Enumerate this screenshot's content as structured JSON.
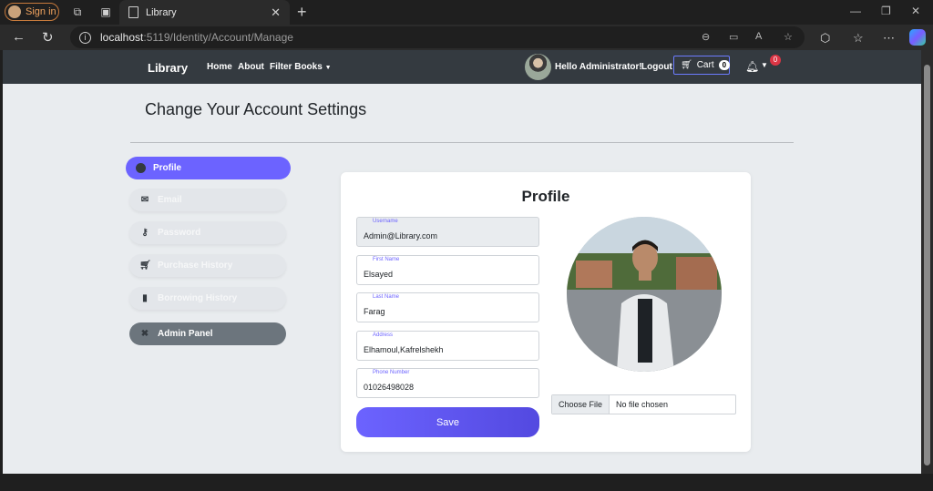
{
  "browser": {
    "signin_label": "Sign in",
    "tab_title": "Library",
    "url_host": "localhost",
    "url_path": ":5119/Identity/Account/Manage"
  },
  "navbar": {
    "brand": "Library",
    "links": [
      "Home",
      "About",
      "Filter Books"
    ],
    "greeting": "Hello Administrator!",
    "logout": "Logout",
    "cart_label": "Cart",
    "cart_count": "0",
    "notification_count": "0"
  },
  "page": {
    "heading": "Change Your Account Settings"
  },
  "sidebar": {
    "items": [
      {
        "label": "Profile",
        "icon": "user-circle-icon"
      },
      {
        "label": "Email",
        "icon": "envelope-icon"
      },
      {
        "label": "Password",
        "icon": "key-icon"
      },
      {
        "label": "Purchase History",
        "icon": "cart-icon"
      },
      {
        "label": "Borrowing History",
        "icon": "book-icon"
      },
      {
        "label": "Admin Panel",
        "icon": "tools-icon"
      }
    ]
  },
  "profile": {
    "title": "Profile",
    "fields": [
      {
        "label": "Username",
        "value": "Admin@Library.com"
      },
      {
        "label": "First Name",
        "value": "Elsayed"
      },
      {
        "label": "Last Name",
        "value": "Farag"
      },
      {
        "label": "Address",
        "value": "Elhamoul,Kafrelshekh"
      },
      {
        "label": "Phone Number",
        "value": "01026498028"
      }
    ],
    "save_label": "Save",
    "choose_file": "Choose File",
    "no_file": "No file chosen"
  },
  "colors": {
    "accent": "#6c63ff",
    "navbar": "#343a40",
    "page_bg": "#e9ecef"
  }
}
